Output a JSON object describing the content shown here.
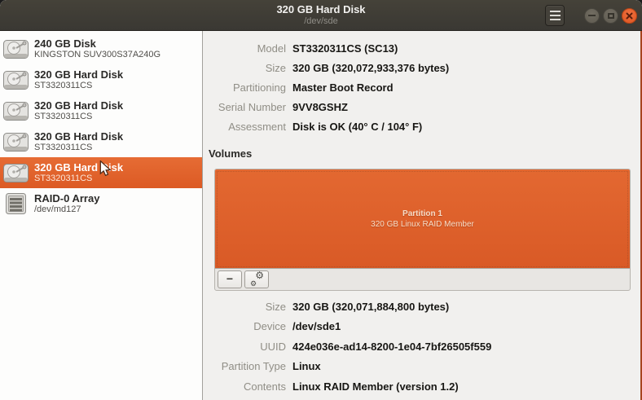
{
  "window": {
    "title": "320 GB Hard Disk",
    "subtitle": "/dev/sde",
    "controls": {
      "menu_icon": "hamburger-menu-icon",
      "minimize_icon": "minimize-icon",
      "maximize_icon": "maximize-icon",
      "close_icon": "close-icon"
    }
  },
  "colors": {
    "accent_orange": "#dd5c26",
    "volume_fill": "#dd5f2b",
    "close_button": "#e8603a",
    "header": "#3b3935",
    "panel_bg": "#f1f0ee"
  },
  "sidebar": {
    "items": [
      {
        "title": "240 GB Disk",
        "subtitle": "KINGSTON SUV300S37A240G",
        "icon": "hard-disk-icon",
        "selected": false
      },
      {
        "title": "320 GB Hard Disk",
        "subtitle": "ST3320311CS",
        "icon": "hard-disk-icon",
        "selected": false
      },
      {
        "title": "320 GB Hard Disk",
        "subtitle": "ST3320311CS",
        "icon": "hard-disk-icon",
        "selected": false
      },
      {
        "title": "320 GB Hard Disk",
        "subtitle": "ST3320311CS",
        "icon": "hard-disk-icon",
        "selected": false
      },
      {
        "title": "320 GB Hard Disk",
        "subtitle": "ST3320311CS",
        "icon": "hard-disk-icon",
        "selected": true
      },
      {
        "title": "RAID-0 Array",
        "subtitle": "/dev/md127",
        "icon": "raid-array-icon",
        "selected": false
      }
    ]
  },
  "details_top": {
    "rows": [
      {
        "label": "Model",
        "value": "ST3320311CS (SC13)"
      },
      {
        "label": "Size",
        "value": "320 GB (320,072,933,376 bytes)"
      },
      {
        "label": "Partitioning",
        "value": "Master Boot Record"
      },
      {
        "label": "Serial Number",
        "value": "9VV8GSHZ"
      },
      {
        "label": "Assessment",
        "value": "Disk is OK (40° C / 104° F)"
      }
    ]
  },
  "volumes": {
    "header": "Volumes",
    "partition": {
      "line1": "Partition 1",
      "line2": "320 GB Linux RAID Member"
    },
    "toolbar": {
      "remove_glyph": "−",
      "gear_glyph": "⚙",
      "remove_name": "delete-partition-button",
      "options_name": "partition-options-button"
    }
  },
  "details_bottom": {
    "rows": [
      {
        "label": "Size",
        "value": "320 GB (320,071,884,800 bytes)"
      },
      {
        "label": "Device",
        "value": "/dev/sde1"
      },
      {
        "label": "UUID",
        "value": "424e036e-ad14-8200-1e04-7bf26505f559"
      },
      {
        "label": "Partition Type",
        "value": "Linux"
      },
      {
        "label": "Contents",
        "value": "Linux RAID Member (version 1.2)"
      }
    ]
  }
}
